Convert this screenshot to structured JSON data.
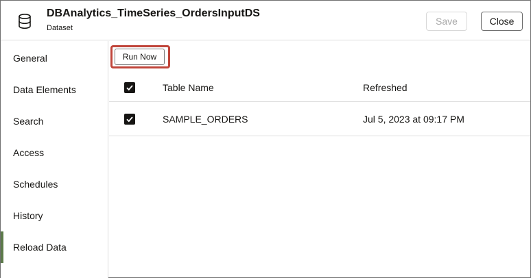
{
  "header": {
    "title": "DBAnalytics_TimeSeries_OrdersInputDS",
    "subtitle": "Dataset",
    "icon": "database-icon",
    "save_label": "Save",
    "close_label": "Close"
  },
  "sidebar": {
    "items": [
      {
        "label": "General"
      },
      {
        "label": "Data Elements"
      },
      {
        "label": "Search"
      },
      {
        "label": "Access"
      },
      {
        "label": "Schedules"
      },
      {
        "label": "History"
      },
      {
        "label": "Reload Data"
      }
    ],
    "active_item": "Reload Data",
    "accent_color": "#5c7a4a"
  },
  "main": {
    "run_now_label": "Run Now",
    "highlight_color": "#c0453a",
    "table": {
      "columns": [
        "Table Name",
        "Refreshed"
      ],
      "header_checked": true,
      "rows": [
        {
          "checked": true,
          "table_name": "SAMPLE_ORDERS",
          "refreshed": "Jul 5, 2023 at 09:17 PM"
        }
      ]
    }
  }
}
